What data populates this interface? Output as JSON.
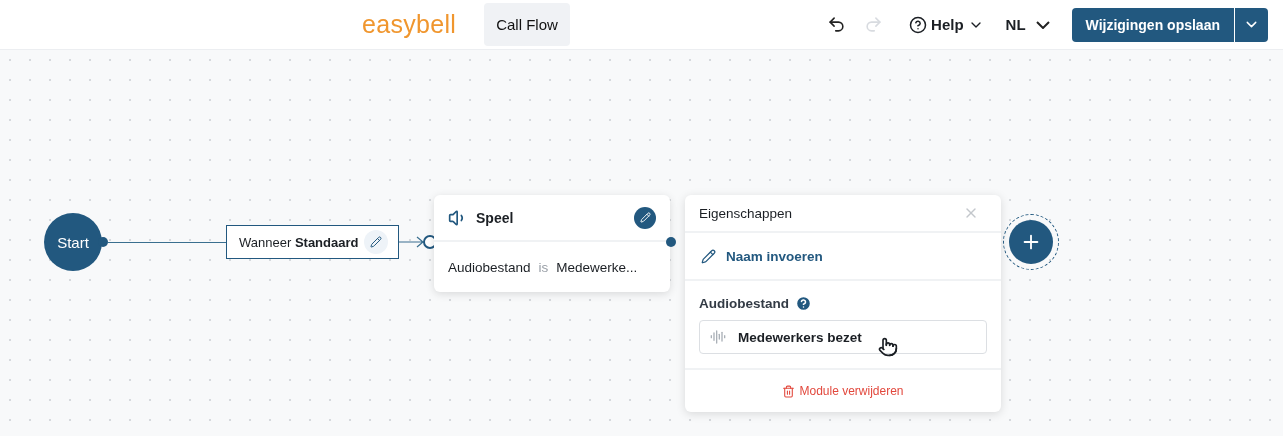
{
  "header": {
    "logo": "easybell",
    "tab": {
      "label": "Call Flow",
      "selected": true
    },
    "undo": {
      "disabled": false
    },
    "redo": {
      "disabled": true
    },
    "help": "Help",
    "language": "NL",
    "save_button": "Wijzigingen opslaan"
  },
  "flow": {
    "start": "Start",
    "condition": "Wanneer **Standaard**",
    "module": {
      "title": "Speel",
      "field": "Audiobestand",
      "operator": "is",
      "value": "Medewerke..."
    }
  },
  "properties": {
    "title": "Eigenschappen",
    "name_link": "Naam invoeren",
    "audio_label": "Audiobestand",
    "audio_value": "Medewerkers bezet",
    "delete": "Module verwijderen"
  }
}
